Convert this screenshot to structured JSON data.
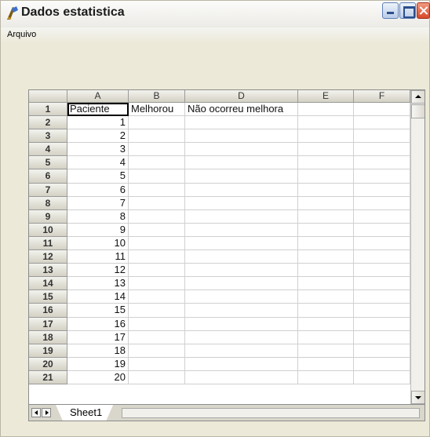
{
  "window": {
    "title": "Dados estatistica"
  },
  "menu": {
    "items": [
      "Arquivo"
    ]
  },
  "sheet": {
    "columns": [
      "A",
      "B",
      "D",
      "E",
      "F"
    ],
    "rows": [
      [
        "1",
        "Paciente",
        "Melhorou",
        "Não ocorreu melhora",
        "",
        ""
      ],
      [
        "2",
        "1",
        "",
        "",
        "",
        ""
      ],
      [
        "3",
        "2",
        "",
        "",
        "",
        ""
      ],
      [
        "4",
        "3",
        "",
        "",
        "",
        ""
      ],
      [
        "5",
        "4",
        "",
        "",
        "",
        ""
      ],
      [
        "6",
        "5",
        "",
        "",
        "",
        ""
      ],
      [
        "7",
        "6",
        "",
        "",
        "",
        ""
      ],
      [
        "8",
        "7",
        "",
        "",
        "",
        ""
      ],
      [
        "9",
        "8",
        "",
        "",
        "",
        ""
      ],
      [
        "10",
        "9",
        "",
        "",
        "",
        ""
      ],
      [
        "11",
        "10",
        "",
        "",
        "",
        ""
      ],
      [
        "12",
        "11",
        "",
        "",
        "",
        ""
      ],
      [
        "13",
        "12",
        "",
        "",
        "",
        ""
      ],
      [
        "14",
        "13",
        "",
        "",
        "",
        ""
      ],
      [
        "15",
        "14",
        "",
        "",
        "",
        ""
      ],
      [
        "16",
        "15",
        "",
        "",
        "",
        ""
      ],
      [
        "17",
        "16",
        "",
        "",
        "",
        ""
      ],
      [
        "18",
        "17",
        "",
        "",
        "",
        ""
      ],
      [
        "19",
        "18",
        "",
        "",
        "",
        ""
      ],
      [
        "20",
        "19",
        "",
        "",
        "",
        ""
      ],
      [
        "21",
        "20",
        "",
        "",
        "",
        ""
      ]
    ],
    "tabs": [
      "Sheet1"
    ]
  }
}
